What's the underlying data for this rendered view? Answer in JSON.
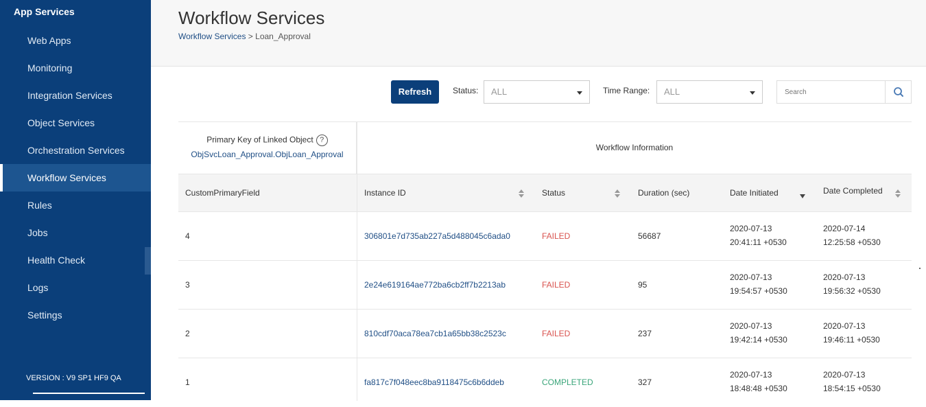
{
  "sidebar": {
    "title": "App Services",
    "items": [
      {
        "label": "Web Apps"
      },
      {
        "label": "Monitoring"
      },
      {
        "label": "Integration Services"
      },
      {
        "label": "Object Services"
      },
      {
        "label": "Orchestration Services"
      },
      {
        "label": "Workflow Services",
        "active": true
      },
      {
        "label": "Rules"
      },
      {
        "label": "Jobs"
      },
      {
        "label": "Health Check"
      },
      {
        "label": "Logs"
      },
      {
        "label": "Settings"
      }
    ],
    "version": "VERSION : V9 SP1 HF9 QA"
  },
  "header": {
    "title": "Workflow Services",
    "breadcrumb": {
      "link": "Workflow Services",
      "separator": " > ",
      "current": "Loan_Approval"
    }
  },
  "toolbar": {
    "refresh_label": "Refresh",
    "status_label": "Status:",
    "status_value": "ALL",
    "time_range_label": "Time Range:",
    "time_range_value": "ALL",
    "search_placeholder": "Search"
  },
  "table": {
    "primary_key_title": "Primary Key of Linked Object",
    "help_icon_glyph": "?",
    "primary_key_object": "ObjSvcLoan_Approval.ObjLoan_Approval",
    "workflow_info_label": "Workflow Information",
    "columns": {
      "custom": "CustomPrimaryField",
      "instance_id": "Instance ID",
      "status": "Status",
      "duration": "Duration (sec)",
      "date_initiated": "Date Initiated",
      "date_completed": "Date Completed"
    },
    "rows": [
      {
        "custom": "4",
        "instance_id": "306801e7d735ab227a5d488045c6ada0",
        "status": "FAILED",
        "duration": "56687",
        "initiated_date": "2020-07-13",
        "initiated_time": "20:41:11 +0530",
        "completed_date": "2020-07-14",
        "completed_time": "12:25:58 +0530"
      },
      {
        "custom": "3",
        "instance_id": "2e24e619164ae772ba6cb2ff7b2213ab",
        "status": "FAILED",
        "duration": "95",
        "initiated_date": "2020-07-13",
        "initiated_time": "19:54:57 +0530",
        "completed_date": "2020-07-13",
        "completed_time": "19:56:32 +0530"
      },
      {
        "custom": "2",
        "instance_id": "810cdf70aca78ea7cb1a65bb38c2523c",
        "status": "FAILED",
        "duration": "237",
        "initiated_date": "2020-07-13",
        "initiated_time": "19:42:14 +0530",
        "completed_date": "2020-07-13",
        "completed_time": "19:46:11 +0530"
      },
      {
        "custom": "1",
        "instance_id": "fa817c7f048eec8ba9118475c6b6ddeb",
        "status": "COMPLETED",
        "duration": "327",
        "initiated_date": "2020-07-13",
        "initiated_time": "18:48:48 +0530",
        "completed_date": "2020-07-13",
        "completed_time": "18:54:15 +0530"
      }
    ]
  },
  "colors": {
    "sidebar_bg": "#0b3f7a",
    "sidebar_active": "#1d5590",
    "failed": "#d9534f",
    "completed": "#3aa57a",
    "link": "#1f4e85"
  },
  "icons": {
    "search": "search-icon",
    "help": "help-icon",
    "dropdown": "caret-down-icon",
    "sort": "sort-icon",
    "sort_desc": "sort-desc-icon"
  }
}
